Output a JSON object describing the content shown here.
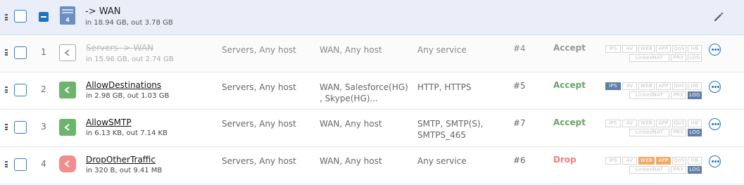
{
  "group": {
    "title": "-> WAN",
    "traffic": "in 18.94 GB, out 3.78 GB",
    "icon_number": "4",
    "icon": "firewall-group-icon",
    "edit_icon": "pencil-icon"
  },
  "tag_labels": {
    "ips": "IPS",
    "av": "AV",
    "web": "WEB",
    "app": "APP",
    "qos": "QoS",
    "hb": "HB",
    "linkednat": "LinkedNAT",
    "prx": "PRX",
    "log": "LOG"
  },
  "rules": [
    {
      "number": "1",
      "name": "Servers -> WAN",
      "traffic": "in 15.96 GB, out 2.74 GB",
      "source": "Servers, Any host",
      "destination": "WAN, Any host",
      "service": "Any service",
      "id": "#4",
      "action": "Accept",
      "icon": "share-icon",
      "active_tags": []
    },
    {
      "number": "2",
      "name": "AllowDestinations",
      "traffic": "in 2.98 GB, out 1.03 GB",
      "source": "Servers, Any host",
      "destination": "WAN, Salesforce(HG) , Skype(HG)...",
      "service": "HTTP, HTTPS",
      "id": "#5",
      "action": "Accept",
      "icon": "share-icon",
      "active_tags": [
        "IPS",
        "LOG"
      ]
    },
    {
      "number": "3",
      "name": "AllowSMTP",
      "traffic": "in 6.13 KB, out 7.14 KB",
      "source": "Servers, Any host",
      "destination": "WAN, Any host",
      "service": "SMTP, SMTP(S), SMTPS_465",
      "id": "#7",
      "action": "Accept",
      "icon": "share-icon",
      "active_tags": [
        "LOG"
      ]
    },
    {
      "number": "4",
      "name": "DropOtherTraffic",
      "traffic": "in 320 B, out 9.41 MB",
      "source": "Servers, Any host",
      "destination": "WAN, Any host",
      "service": "Any service",
      "id": "#6",
      "action": "Drop",
      "icon": "share-icon",
      "active_tags": [
        "WEB",
        "APP",
        "LOG"
      ]
    }
  ],
  "colors": {
    "accent": "#1e73be",
    "accept": "#6aa56a",
    "drop": "#ef8080",
    "group_bg": "#e9eef9"
  }
}
